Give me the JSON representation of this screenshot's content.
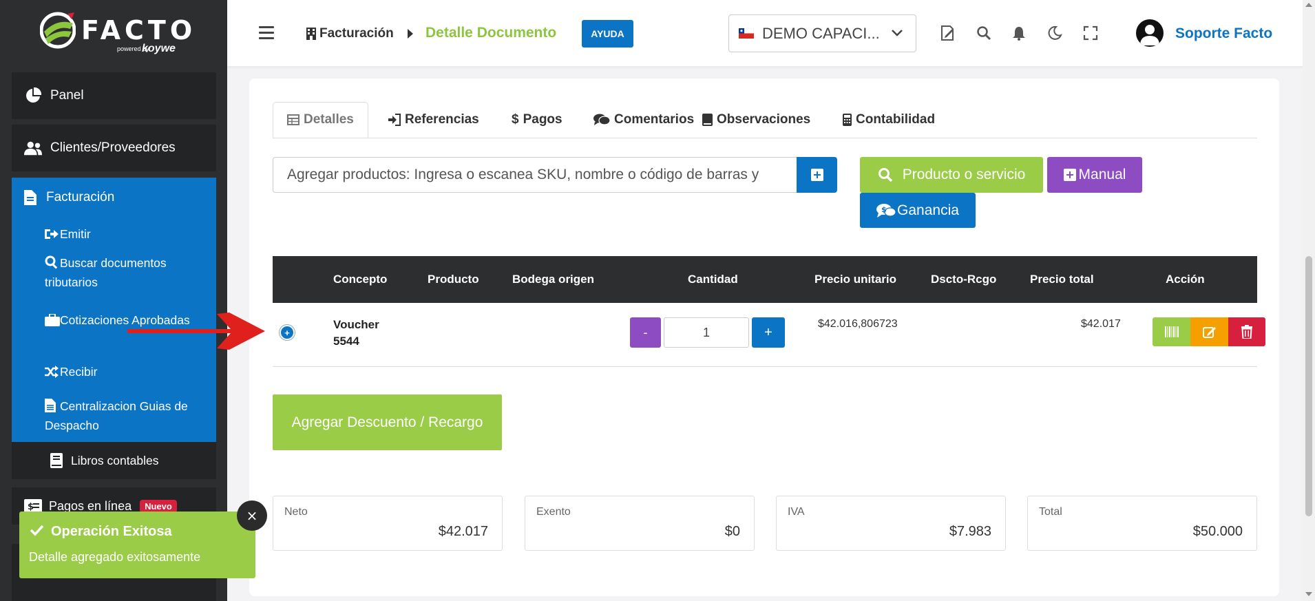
{
  "sidebar": {
    "logo_text": "FACTO",
    "logo_powered": "powered by",
    "logo_brand": "koywe",
    "items": [
      {
        "label": "Panel",
        "icon": "pie-chart-icon"
      },
      {
        "label": "Clientes/Proveedores",
        "icon": "users-icon"
      }
    ],
    "facturacion": {
      "label": "Facturación",
      "icon": "file-icon",
      "subitems": [
        {
          "label": "Emitir",
          "icon": "sign-out-icon"
        },
        {
          "label": "Buscar documentos tributarios",
          "icon": "search-icon"
        },
        {
          "label": "Cotizaciones Aprobadas",
          "icon": "briefcase-icon"
        },
        {
          "label": "Recibir",
          "icon": "shuffle-icon"
        },
        {
          "label": "Centralizacion Guias de Despacho",
          "icon": "file-text-icon"
        }
      ]
    },
    "libros": {
      "label": "Libros contables",
      "icon": "book-icon"
    },
    "pagos": {
      "label": "Pagos en línea",
      "badge": "Nuevo",
      "icon": "money-icon"
    }
  },
  "toast": {
    "title": "Operación Exitosa",
    "message": "Detalle agregado exitosamente",
    "close": "×",
    "color": "#9bcc47"
  },
  "topbar": {
    "breadcrumb_home": "Facturación",
    "breadcrumb_current": "Detalle Documento",
    "help_label": "AYUDA",
    "company": "DEMO CAPACI...",
    "user_name": "Soporte Facto",
    "icons": [
      "signature-icon",
      "search-icon",
      "bell-icon",
      "moon-icon",
      "fullscreen-icon"
    ]
  },
  "tabs": [
    {
      "label": "Detalles",
      "active": true
    },
    {
      "label": "Referencias"
    },
    {
      "label": "Pagos",
      "prefix": "$"
    },
    {
      "label": "Comentarios"
    },
    {
      "label": "Observaciones"
    },
    {
      "label": "Contabilidad"
    }
  ],
  "search": {
    "placeholder": "Agregar productos: Ingresa o escanea SKU, nombre o código de barras y"
  },
  "buttons": {
    "producto": "Producto o servicio",
    "manual": "Manual",
    "ganancia": "Ganancia",
    "descuento": "Agregar Descuento / Recargo"
  },
  "table": {
    "headers": [
      "Concepto",
      "Producto",
      "Bodega origen",
      "Cantidad",
      "Precio unitario",
      "Dscto-Rcgo",
      "Precio total",
      "Acción"
    ],
    "rows": [
      {
        "concepto": "Voucher 5544",
        "producto": "",
        "bodega": "",
        "cantidad": "1",
        "precio_unitario": "$42.016,806723",
        "dscto": "",
        "precio_total": "$42.017",
        "minus": "-",
        "plus": "+"
      }
    ]
  },
  "summary": {
    "neto": {
      "label": "Neto",
      "value": "$42.017"
    },
    "exento": {
      "label": "Exento",
      "value": "$0"
    },
    "iva": {
      "label": "IVA",
      "value": "$7.983"
    },
    "total": {
      "label": "Total",
      "value": "$50.000"
    }
  },
  "colors": {
    "primary_blue": "#0b74c4",
    "green": "#9bcc47",
    "purple": "#8e4cc3",
    "orange": "#f6a000",
    "red": "#d6203d",
    "sidebar_dark": "#2d2e30"
  }
}
